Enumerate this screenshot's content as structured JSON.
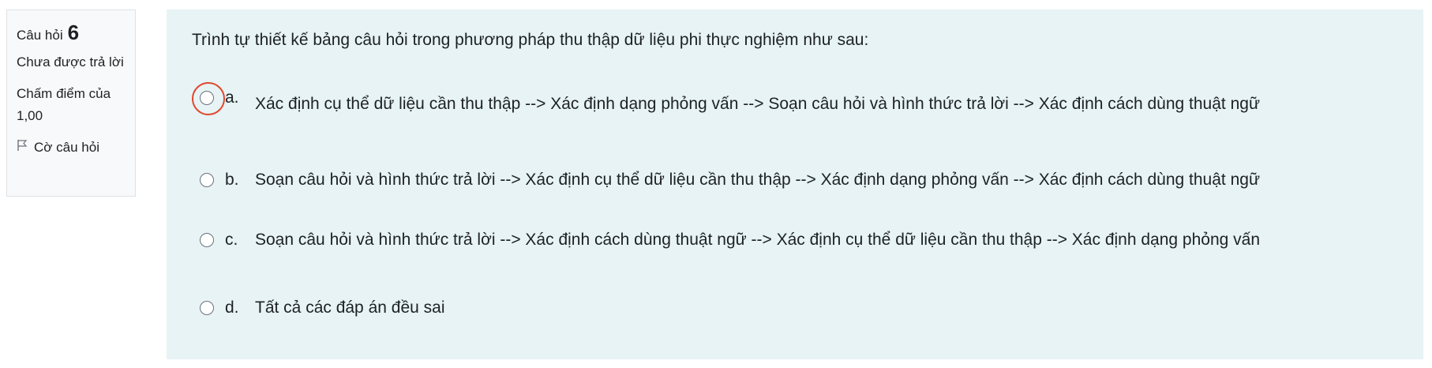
{
  "info": {
    "question_label": "Câu hỏi",
    "question_number": "6",
    "state": "Chưa được trả lời",
    "grade": "Chấm điểm của 1,00",
    "flag_label": "Cờ câu hỏi"
  },
  "question": {
    "text": "Trình tự thiết kế bảng câu hỏi trong phương pháp thu thập dữ liệu phi thực nghiệm như sau:",
    "answers": [
      {
        "letter": "a.",
        "text": "Xác định cụ thể dữ liệu cần thu thập --> Xác định dạng phỏng vấn --> Soạn câu hỏi và hình thức trả lời --> Xác định cách dùng thuật ngữ"
      },
      {
        "letter": "b.",
        "text": "Soạn câu hỏi và hình thức trả lời --> Xác định cụ thể dữ liệu cần thu thập --> Xác định dạng phỏng vấn --> Xác định cách dùng thuật ngữ"
      },
      {
        "letter": "c.",
        "text": "Soạn câu hỏi và hình thức trả lời --> Xác định cách dùng thuật ngữ --> Xác định cụ thể dữ liệu cần thu thập --> Xác định dạng phỏng vấn"
      },
      {
        "letter": "d.",
        "text": "Tất cả các đáp án đều sai"
      }
    ]
  },
  "colors": {
    "content_bg": "#e7f3f5",
    "info_bg": "#f8f9fa",
    "highlight": "#e0492f"
  }
}
